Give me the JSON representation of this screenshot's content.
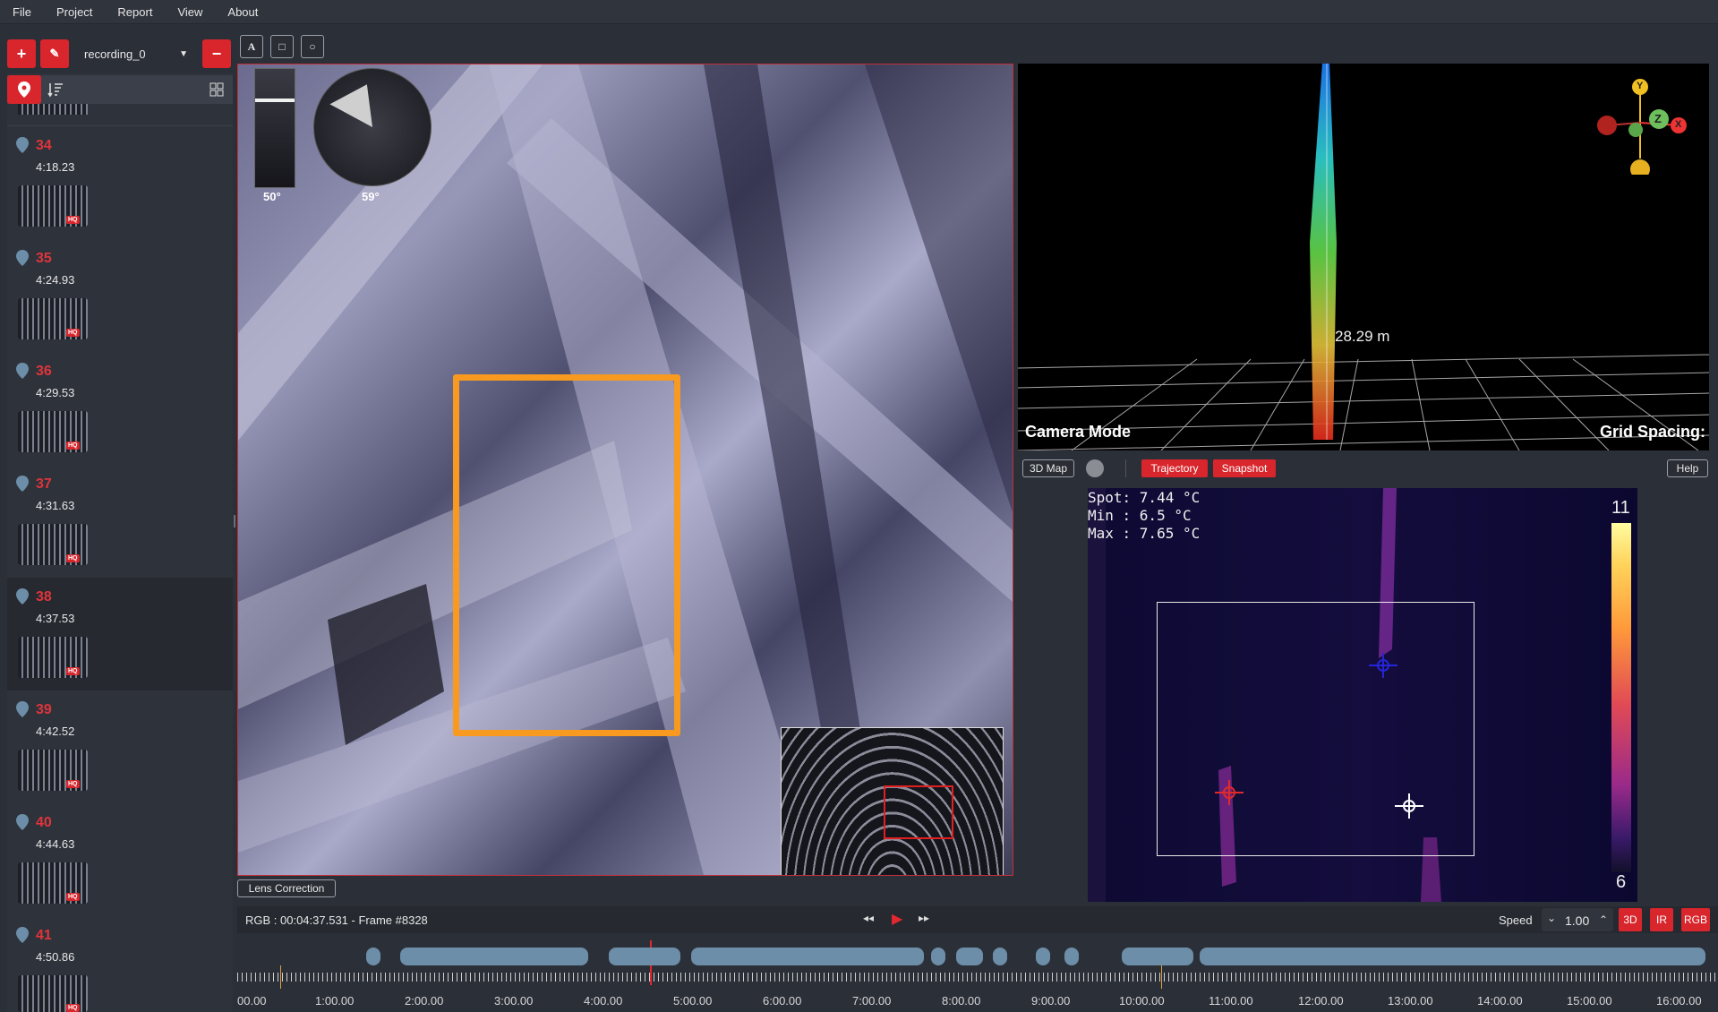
{
  "menu": [
    "File",
    "Project",
    "Report",
    "View",
    "About"
  ],
  "toolbar": {
    "add": "+",
    "edit": "✎",
    "recording": "recording_0",
    "remove": "−"
  },
  "draw_tools": [
    "A",
    "□",
    "○"
  ],
  "snapshots": [
    {
      "num": "34",
      "time": "4:18.23",
      "hq": "HQ",
      "pin": "34"
    },
    {
      "num": "35",
      "time": "4:24.93",
      "hq": "HQ",
      "pin": "35"
    },
    {
      "num": "36",
      "time": "4:29.53",
      "hq": "HQ",
      "pin": "36"
    },
    {
      "num": "37",
      "time": "4:31.63",
      "hq": "HQ",
      "pin": "37"
    },
    {
      "num": "38",
      "time": "4:37.53",
      "hq": "HQ",
      "pin": "38"
    },
    {
      "num": "39",
      "time": "4:42.52",
      "hq": "HQ",
      "pin": "39"
    },
    {
      "num": "40",
      "time": "4:44.63",
      "hq": "HQ",
      "pin": "40"
    },
    {
      "num": "41",
      "time": "4:50.86",
      "hq": "HQ",
      "pin": "41"
    }
  ],
  "rgb_view": {
    "gauge1": "50°",
    "gauge2": "59°",
    "lens_correction": "Lens Correction"
  },
  "map_view": {
    "distance": "28.29 m",
    "camera_mode": "Camera Mode",
    "grid_spacing": "Grid Spacing:",
    "btn_3dmap": "3D Map",
    "btn_trajectory": "Trajectory",
    "btn_snapshot": "Snapshot",
    "btn_help": "Help",
    "axis_y": "Y",
    "axis_z": "Z",
    "axis_x": "X"
  },
  "thermal": {
    "spot": "Spot: 7.44  °C",
    "min": "Min : 6.5  °C",
    "max": "Max : 7.65  °C",
    "scale_max": "11",
    "scale_min": "6"
  },
  "playback": {
    "info": "RGB : 00:04:37.531 - Frame #8328",
    "speed_label": "Speed",
    "speed_value": "1.00",
    "btn_3d": "3D",
    "btn_ir": "IR",
    "btn_rgb": "RGB"
  },
  "timeline": {
    "ticks": [
      "00.00",
      "1:00.00",
      "2:00.00",
      "3:00.00",
      "4:00.00",
      "5:00.00",
      "6:00.00",
      "7:00.00",
      "8:00.00",
      "9:00.00",
      "10:00.00",
      "11:00.00",
      "12:00.00",
      "13:00.00",
      "14:00.00",
      "15:00.00",
      "16:00.00"
    ]
  },
  "colors": {
    "accent": "#d8262c",
    "box": "#f79a1f"
  }
}
